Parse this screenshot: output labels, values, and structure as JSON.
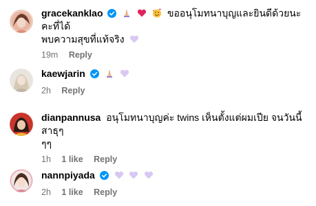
{
  "comments": [
    {
      "username": "gracekanklao",
      "verified": true,
      "text_line1": "ขออนุโมทนาบุญและยินดีด้วยนะคะที่ได้",
      "text_line2": "พบความสุขที่แท้จริง",
      "time": "19m",
      "reply": "Reply"
    },
    {
      "username": "kaewjarin",
      "verified": true,
      "time": "2h",
      "reply": "Reply"
    },
    {
      "username": "dianpannusa",
      "verified": false,
      "text_line1": "อนุโมทนาบุญค่ะ twins เห็นตั้งแต่ผมเปีย จนวันนี้ สาธุๆ",
      "text_line2": "ๆๆ",
      "time": "1h",
      "likes": "1 like",
      "reply": "Reply"
    },
    {
      "username": "nannpiyada",
      "verified": true,
      "time": "2h",
      "likes": "1 like",
      "reply": "Reply"
    }
  ],
  "colors": {
    "verified": "#0095f6",
    "meta": "#737373",
    "heart_purple": "#d9c8f3"
  }
}
